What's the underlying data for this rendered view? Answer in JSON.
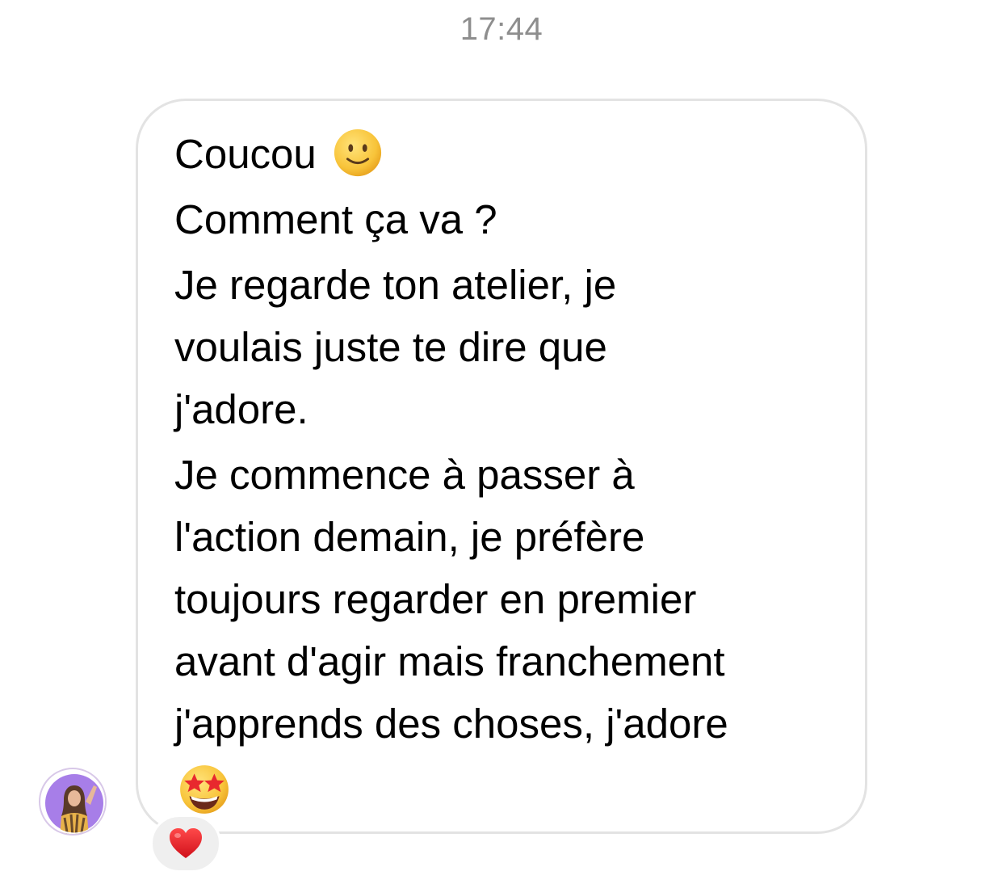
{
  "chat": {
    "timestamp": "17:44"
  },
  "message": {
    "lines": [
      "Coucou",
      "Comment ça va ?",
      "Je regarde ton atelier, je",
      "voulais juste te dire que",
      "j'adore.",
      "Je commence à passer à",
      "l'action demain, je préfère",
      "toujours regarder en premier",
      "avant d'agir mais franchement",
      "j'apprends des choses, j'adore"
    ],
    "emojis": {
      "first_line_icon": "slightly-smiling-face-icon",
      "end_icon": "star-struck-face-icon"
    },
    "bubble_border_color": "#e3e3e3"
  },
  "sender": {
    "avatar_icon": "profile-photo-avatar",
    "avatar_ring_color": "#a77ee8"
  },
  "reaction": {
    "icon": "red-heart-icon",
    "color": "#e0141e",
    "background": "#efefef"
  }
}
